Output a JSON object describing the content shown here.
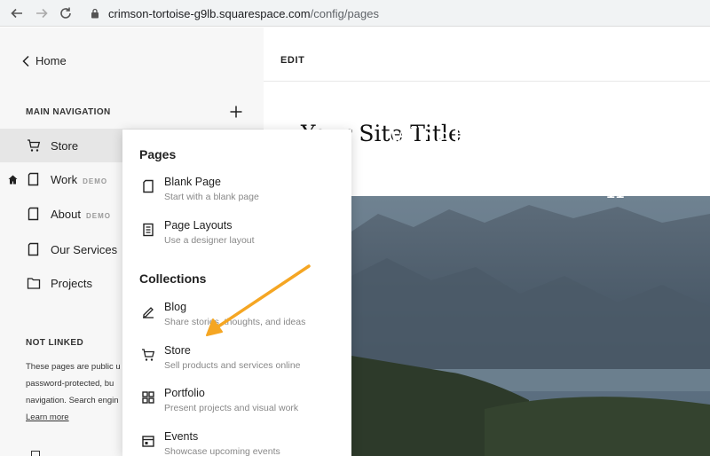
{
  "browser": {
    "url_host": "crimson-tortoise-g9lb.squarespace.com",
    "url_path": "/config/pages"
  },
  "sidebar": {
    "back_label": "Home",
    "main_nav_label": "MAIN NAVIGATION",
    "items": [
      {
        "label": "Store",
        "demo": "",
        "icon": "cart-icon"
      },
      {
        "label": "Work",
        "demo": "DEMO",
        "icon": "page-icon"
      },
      {
        "label": "About",
        "demo": "DEMO",
        "icon": "page-icon"
      },
      {
        "label": "Our Services",
        "demo": "",
        "icon": "page-icon"
      },
      {
        "label": "Projects",
        "demo": "",
        "icon": "folder-icon"
      }
    ],
    "not_linked_label": "NOT LINKED",
    "not_linked_lines": [
      "These pages are public u",
      "password-protected, bu",
      "navigation. Search engin"
    ],
    "learn_more": "Learn more"
  },
  "preview": {
    "edit_label": "EDIT",
    "site_title": "Your Site Title",
    "hero_line1": "Whatever it is, t",
    "hero_line2": "n"
  },
  "panel": {
    "pages_heading": "Pages",
    "pages": [
      {
        "title": "Blank Page",
        "desc": "Start with a blank page",
        "icon": "blank-page-icon"
      },
      {
        "title": "Page Layouts",
        "desc": "Use a designer layout",
        "icon": "layout-icon"
      }
    ],
    "collections_heading": "Collections",
    "collections": [
      {
        "title": "Blog",
        "desc": "Share stories, thoughts, and ideas",
        "icon": "pen-icon"
      },
      {
        "title": "Store",
        "desc": "Sell products and services online",
        "icon": "cart-icon"
      },
      {
        "title": "Portfolio",
        "desc": "Present projects and visual work",
        "icon": "grid-icon"
      },
      {
        "title": "Events",
        "desc": "Showcase upcoming events",
        "icon": "calendar-icon"
      }
    ]
  },
  "colors": {
    "arrow": "#f5a623",
    "sidebar_bg": "#f7f7f7",
    "active_bg": "#e6e6e6"
  }
}
